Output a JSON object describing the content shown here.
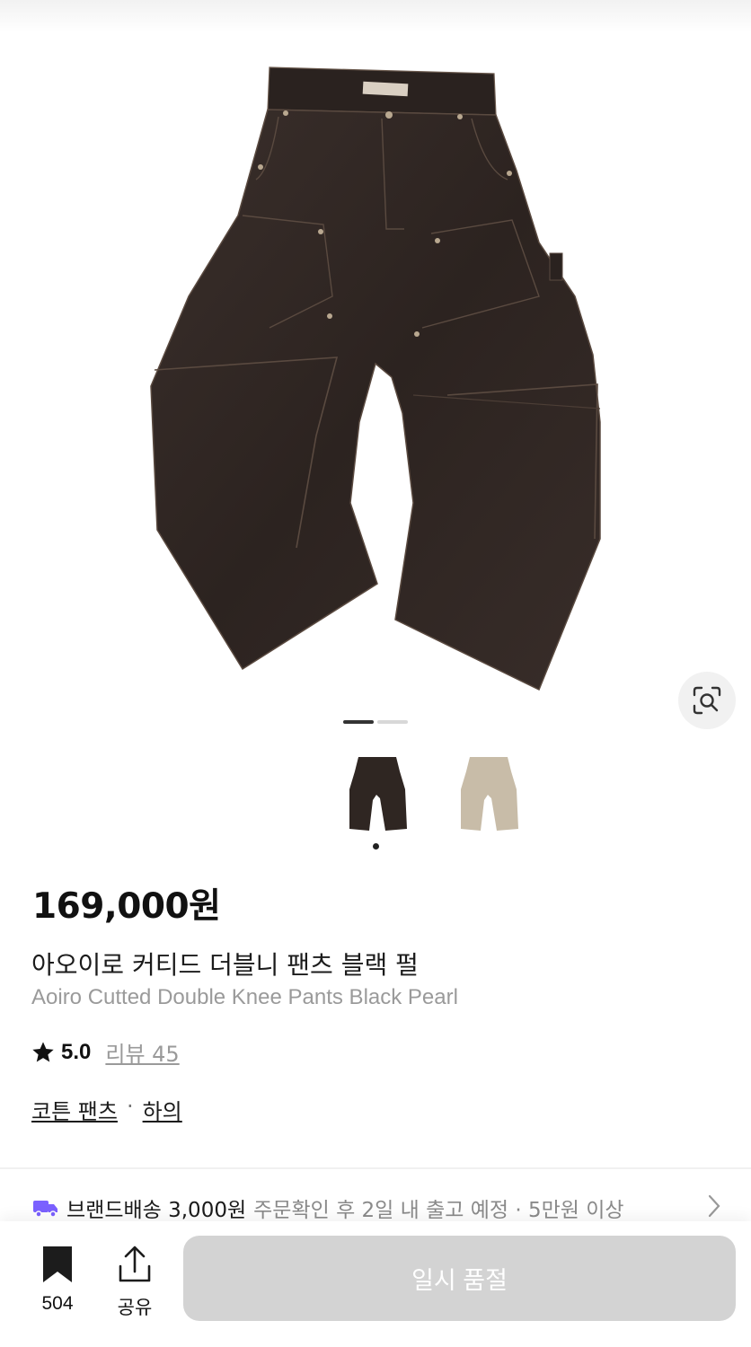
{
  "product": {
    "price": "169,000원",
    "name_ko": "아오이로 커티드 더블니 팬츠 블랙 펄",
    "name_en": "Aoiro Cutted Double Knee Pants Black Pearl",
    "rating": "5.0",
    "review_label": "리뷰 45",
    "category": [
      "코튼 팬츠",
      "하의"
    ],
    "category_separator": "·"
  },
  "gallery": {
    "page_count": 2,
    "current_page": 1,
    "thumbnails": [
      {
        "color": "#2f2622",
        "selected": true
      },
      {
        "color": "#c8bca8",
        "selected": false
      }
    ]
  },
  "delivery": {
    "label": "브랜드배송 3,000원",
    "info": "주문확인 후 2일 내 출고 예정 · 5만원 이상",
    "icon": "truck-icon",
    "icon_color": "#7b61ff"
  },
  "bottom_bar": {
    "bookmark_count": "504",
    "share_label": "공유",
    "soldout_label": "일시 품절"
  }
}
